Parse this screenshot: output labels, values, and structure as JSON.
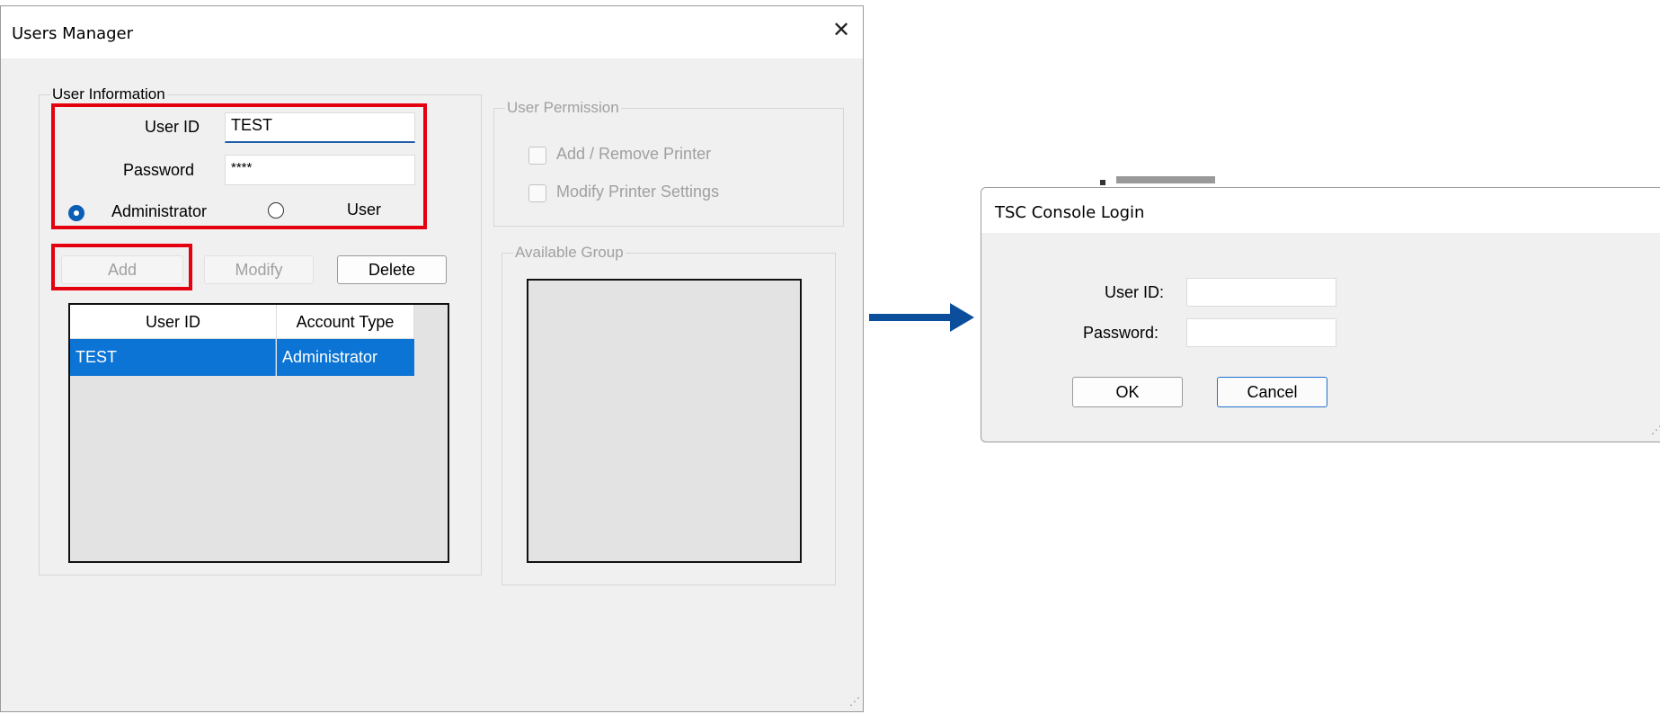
{
  "users_manager": {
    "title": "Users Manager",
    "close_glyph": "✕",
    "user_information": {
      "legend": "User Information",
      "user_id_label": "User ID",
      "user_id_value": "TEST",
      "password_label": "Password",
      "password_value": "****",
      "role_admin_label": "Administrator",
      "role_user_label": "User",
      "selected_role": "Administrator"
    },
    "buttons": {
      "add": "Add",
      "modify": "Modify",
      "delete": "Delete"
    },
    "users_table": {
      "columns": [
        "User ID",
        "Account Type"
      ],
      "rows": [
        {
          "user_id": "TEST",
          "account_type": "Administrator",
          "selected": true
        }
      ]
    },
    "user_permission": {
      "legend": "User Permission",
      "options": [
        {
          "label": "Add / Remove Printer",
          "checked": false
        },
        {
          "label": "Modify Printer Settings",
          "checked": false
        }
      ]
    },
    "available_group": {
      "legend": "Available Group"
    }
  },
  "arrow": {
    "color": "#0b4f9c",
    "direction": "right"
  },
  "login": {
    "title": "TSC Console Login",
    "user_id_label": "User ID:",
    "password_label": "Password:",
    "user_id_value": "",
    "password_value": "",
    "ok_label": "OK",
    "cancel_label": "Cancel"
  },
  "colors": {
    "highlight_red": "#e4000f",
    "selection_blue": "#0c74d4",
    "radio_blue": "#0a5fb5"
  }
}
